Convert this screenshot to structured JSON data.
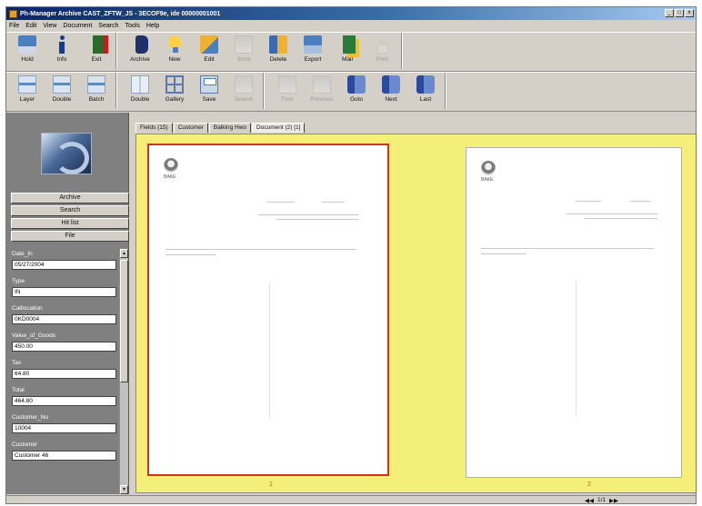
{
  "window": {
    "title": "Ph-Manager Archive CAST_ZFTW_JS - 3ECOF9e, ide 00000001001",
    "controls": [
      "_",
      "□",
      "x"
    ]
  },
  "menu": [
    "File",
    "Edit",
    "View",
    "Document",
    "Search",
    "Tools",
    "Help"
  ],
  "toolbar1": [
    {
      "label": "Hold",
      "icon": "hold-icon",
      "enabled": true
    },
    {
      "label": "Info",
      "icon": "info-icon",
      "enabled": true
    },
    {
      "label": "Exit",
      "icon": "exit-icon",
      "enabled": true
    },
    {
      "label": "Archive",
      "icon": "archive-icon",
      "enabled": true
    },
    {
      "label": "New",
      "icon": "new-icon",
      "enabled": true
    },
    {
      "label": "Edit",
      "icon": "edit-icon",
      "enabled": true
    },
    {
      "label": "Store",
      "icon": "store-icon",
      "enabled": false
    },
    {
      "label": "Delete",
      "icon": "delete-icon",
      "enabled": true
    },
    {
      "label": "Export",
      "icon": "export-icon",
      "enabled": true
    },
    {
      "label": "Mail",
      "icon": "mail-icon",
      "enabled": true
    },
    {
      "label": "Print",
      "icon": "print-icon",
      "enabled": false
    }
  ],
  "toolbar2": [
    {
      "label": "Layer",
      "icon": "layer-icon",
      "enabled": true
    },
    {
      "label": "Double",
      "icon": "double-icon",
      "enabled": true
    },
    {
      "label": "Batch",
      "icon": "batch-icon",
      "enabled": true
    },
    {
      "label": "Double",
      "icon": "double-page-icon",
      "enabled": true
    },
    {
      "label": "Gallery",
      "icon": "gallery-icon",
      "enabled": true
    },
    {
      "label": "Save",
      "icon": "save-icon",
      "enabled": true
    },
    {
      "label": "Search",
      "icon": "search-icon",
      "enabled": false
    },
    {
      "label": "First",
      "icon": "first-icon",
      "enabled": false
    },
    {
      "label": "Previous",
      "icon": "previous-icon",
      "enabled": false
    },
    {
      "label": "Goto",
      "icon": "goto-icon",
      "enabled": true
    },
    {
      "label": "Next",
      "icon": "next-icon",
      "enabled": true
    },
    {
      "label": "Last",
      "icon": "last-icon",
      "enabled": true
    }
  ],
  "nav_buttons": [
    "Archive",
    "Search",
    "Hit list",
    "File"
  ],
  "fields": [
    {
      "label": "Date_In",
      "value": "05/27/2004"
    },
    {
      "label": "Type",
      "value": "IN"
    },
    {
      "label": "Calllocation",
      "value": "0KD0004"
    },
    {
      "label": "Value_of_Goods",
      "value": "450.00"
    },
    {
      "label": "Tax",
      "value": "64.80"
    },
    {
      "label": "Total",
      "value": "464.80"
    },
    {
      "label": "Customer_No",
      "value": "10004"
    },
    {
      "label": "Customer",
      "value": "Customer 46"
    }
  ],
  "tabs": [
    "Fields (15)",
    "Customer",
    "Balking Hwo",
    "Document (2) [1]"
  ],
  "pages": [
    {
      "number": "1",
      "logo_text": "BAKE",
      "selected": true
    },
    {
      "number": "2",
      "logo_text": "BAKE",
      "selected": false
    }
  ],
  "status": {
    "page_info": "1/1"
  }
}
